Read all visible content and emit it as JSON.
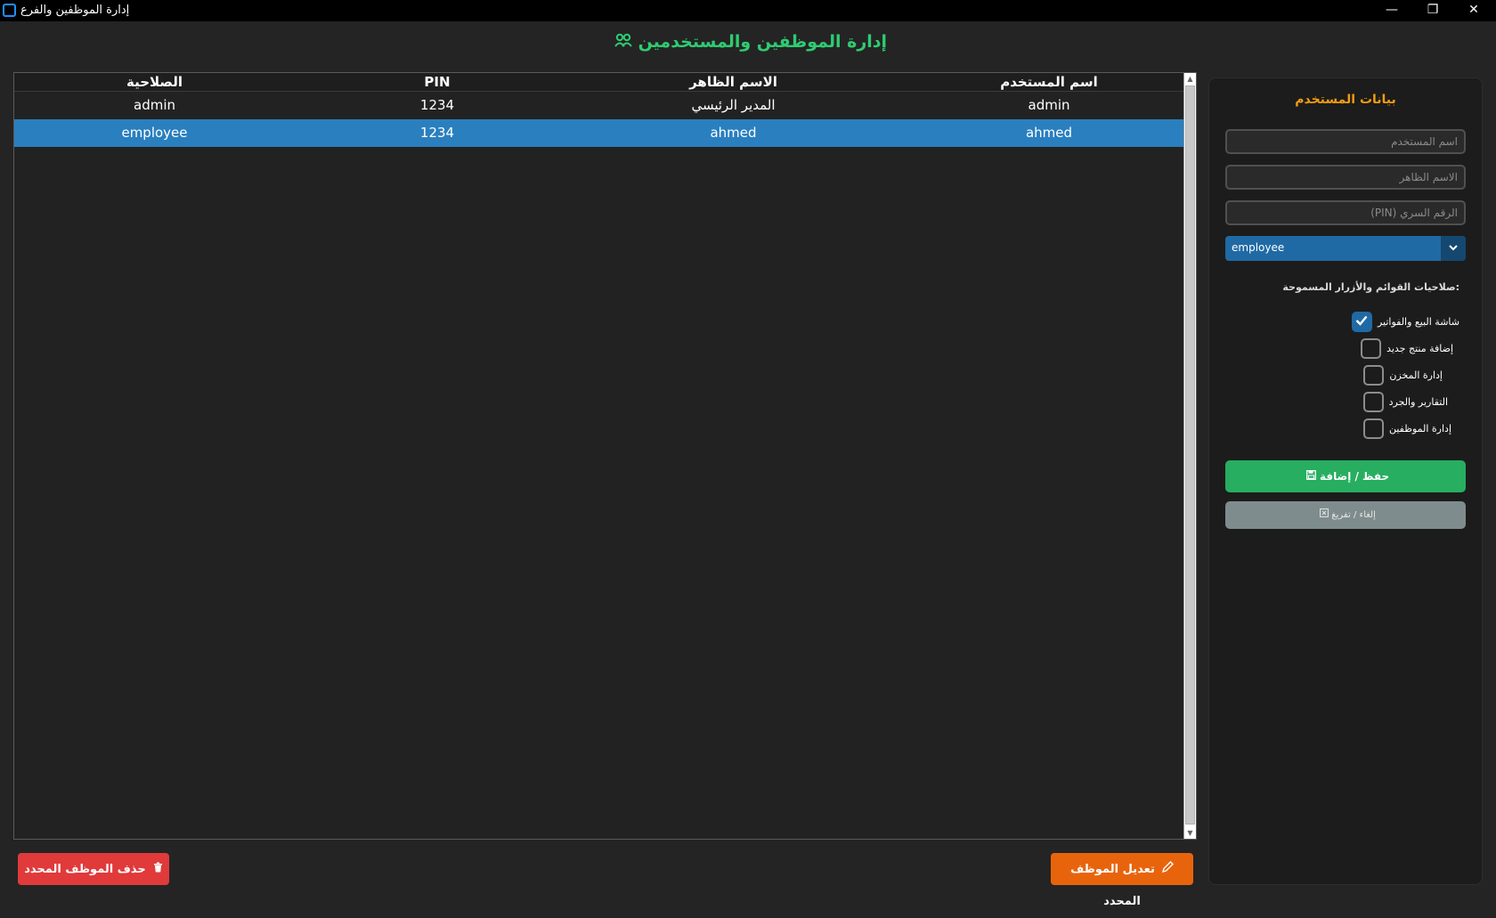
{
  "window": {
    "title": "إدارة الموظفين والفرع",
    "minimize": "—",
    "restore": "❐",
    "close": "✕"
  },
  "header": {
    "title": "إدارة الموظفين والمستخدمين",
    "icon": "users-icon",
    "color": "#2ecc71"
  },
  "table": {
    "columns": [
      "اسم المستخدم",
      "الاسم الظاهر",
      "PIN",
      "الصلاحية"
    ],
    "rows": [
      {
        "username": "admin",
        "display": "المدير الرئيسي",
        "pin": "1234",
        "role": "admin",
        "selected": false
      },
      {
        "username": "ahmed",
        "display": "ahmed",
        "pin": "1234",
        "role": "employee",
        "selected": true
      }
    ]
  },
  "actions": {
    "delete_label": "حذف الموظف المحدد",
    "delete_icon": "trash-icon",
    "edit_label": "تعديل الموظف المحدد",
    "edit_icon": "pencil-icon"
  },
  "panel": {
    "title": "بيانات المستخدم",
    "username_placeholder": "اسم المستخدم",
    "display_placeholder": "الاسم الظاهر",
    "pin_placeholder": "الرقم السري (PIN)",
    "role_value": "employee",
    "permissions_title": ":صلاحيات القوائم والأزرار المسموحة",
    "permissions": [
      {
        "label": "شاشة البيع والفواتير",
        "checked": true
      },
      {
        "label": "إضافة منتج جديد",
        "checked": false
      },
      {
        "label": "إدارة المخزن",
        "checked": false
      },
      {
        "label": "التقارير والجرد",
        "checked": false
      },
      {
        "label": "إدارة الموظفين",
        "checked": false
      }
    ],
    "save_label": "حفظ / إضافة",
    "save_icon": "floppy-icon",
    "clear_label": "إلغاء / تفريغ",
    "clear_icon": "clear-icon"
  },
  "colors": {
    "accent": "#1f6aa5",
    "selected_row": "#2a7fbf",
    "save": "#27ae60",
    "delete": "#e03a3a",
    "edit": "#e8640c",
    "panel_title": "#f39c12"
  }
}
